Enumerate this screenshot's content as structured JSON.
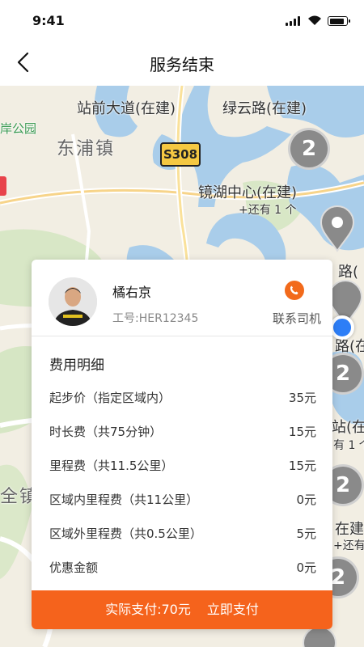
{
  "status_bar": {
    "time": "9:41"
  },
  "header": {
    "title": "服务结束"
  },
  "map": {
    "labels": {
      "zhanqian": "站前大道(在建)",
      "luyun": "绿云路(在建)",
      "anpark": "岸公园",
      "dongpu": "东浦镇",
      "road_code": "S308",
      "jinghu": "镜湖中心(在建)",
      "more": "+还有 1 个",
      "quanzhen": "全镇",
      "right1": "路(",
      "right2": "路(在",
      "right3": "站(在",
      "right4": "有 1 个",
      "right5": "在建",
      "right6": "+还有"
    },
    "clusters": [
      "2",
      "2",
      "2",
      "2"
    ]
  },
  "driver": {
    "name": "橘右京",
    "id_label": "工号:HER12345",
    "contact_label": "联系司机"
  },
  "fees": {
    "title": "费用明细",
    "items": [
      {
        "label": "起步价（指定区域内）",
        "value": "35元"
      },
      {
        "label": "时长费（共75分钟）",
        "value": "15元"
      },
      {
        "label": "里程费（共11.5公里）",
        "value": "15元"
      },
      {
        "label": "区域内里程费（共11公里）",
        "value": "0元"
      },
      {
        "label": "区域外里程费（共0.5公里）",
        "value": "5元"
      },
      {
        "label": "优惠金额",
        "value": "0元"
      }
    ]
  },
  "payment": {
    "total_label": "实际支付:70元",
    "pay_now_label": "立即支付"
  },
  "colors": {
    "accent": "#f5631c",
    "location": "#2d7ef7"
  }
}
